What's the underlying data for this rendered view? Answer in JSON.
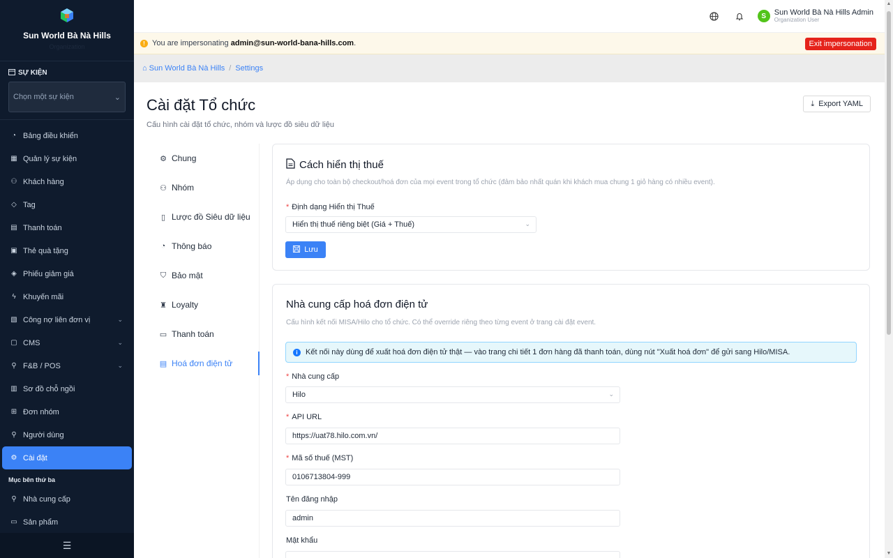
{
  "sidebar": {
    "brand_name": "Sun World Bà Nà Hills",
    "brand_sub": "Organization",
    "event_label": "SỰ KIỆN",
    "event_placeholder": "Chọn một sự kiện",
    "items": [
      {
        "label": "Bảng điều khiển",
        "icon": "dashboard-icon"
      },
      {
        "label": "Quản lý sự kiện",
        "icon": "calendar-icon"
      },
      {
        "label": "Khách hàng",
        "icon": "users-icon"
      },
      {
        "label": "Tag",
        "icon": "tag-icon"
      },
      {
        "label": "Thanh toán",
        "icon": "payment-icon"
      },
      {
        "label": "Thẻ quà tặng",
        "icon": "gift-icon"
      },
      {
        "label": "Phiếu giảm giá",
        "icon": "coupon-icon"
      },
      {
        "label": "Khuyến mãi",
        "icon": "promotion-icon"
      },
      {
        "label": "Công nợ liên đơn vị",
        "icon": "debt-icon"
      },
      {
        "label": "CMS",
        "icon": "cms-icon"
      },
      {
        "label": "F&B / POS",
        "icon": "fnb-icon"
      },
      {
        "label": "Sơ đồ chỗ ngồi",
        "icon": "seatmap-icon"
      },
      {
        "label": "Đơn nhóm",
        "icon": "group-order-icon"
      },
      {
        "label": "Người dùng",
        "icon": "user-icon"
      },
      {
        "label": "Cài đặt",
        "icon": "settings-icon"
      }
    ],
    "group_label": "Mục bên thứ ba",
    "third_party": [
      {
        "label": "Nhà cung cấp",
        "icon": "supplier-icon"
      },
      {
        "label": "Sản phẩm",
        "icon": "product-icon"
      }
    ]
  },
  "topbar": {
    "user_name": "Sun World Bà Nà Hills Admin",
    "user_role": "Organization User",
    "avatar_letter": "S"
  },
  "banner": {
    "prefix": "You are impersonating ",
    "email": "admin@sun-world-bana-hills.com",
    "suffix": ".",
    "exit_label": "Exit impersonation"
  },
  "breadcrumb": {
    "home": "Sun World Bà Nà Hills",
    "current": "Settings"
  },
  "page": {
    "title": "Cài đặt Tổ chức",
    "subtitle": "Cấu hình cài đặt tổ chức, nhóm và lược đồ siêu dữ liệu",
    "export_label": "Export YAML"
  },
  "subnav": [
    {
      "label": "Chung",
      "icon": "gear-icon"
    },
    {
      "label": "Nhóm",
      "icon": "team-icon"
    },
    {
      "label": "Lược đồ Siêu dữ liệu",
      "icon": "schema-icon"
    },
    {
      "label": "Thông báo",
      "icon": "bell-icon"
    },
    {
      "label": "Bảo mật",
      "icon": "shield-icon"
    },
    {
      "label": "Loyalty",
      "icon": "trophy-icon"
    },
    {
      "label": "Thanh toán",
      "icon": "card-icon"
    },
    {
      "label": "Hoá đơn điện tử",
      "icon": "invoice-icon"
    }
  ],
  "tax_card": {
    "title": "Cách hiển thị thuế",
    "desc": "Áp dụng cho toàn bộ checkout/hoá đơn của mọi event trong tổ chức (đảm bảo nhất quán khi khách mua chung 1 giỏ hàng có nhiều event).",
    "field_label": "Định dạng Hiển thị Thuế",
    "field_value": "Hiển thị thuế riêng biệt (Giá + Thuế)",
    "save_label": "Lưu"
  },
  "einvoice_card": {
    "title": "Nhà cung cấp hoá đơn điện tử",
    "desc": "Cấu hình kết nối MISA/Hilo cho tổ chức. Có thể override riêng theo từng event ở trang cài đặt event.",
    "info": "Kết nối này dùng để xuất hoá đơn điện tử thật — vào trang chi tiết 1 đơn hàng đã thanh toán, dùng nút \"Xuất hoá đơn\" để gửi sang Hilo/MISA.",
    "provider_label": "Nhà cung cấp",
    "provider_value": "Hilo",
    "api_label": "API URL",
    "api_value": "https://uat78.hilo.com.vn/",
    "tax_label": "Mã số thuế (MST)",
    "tax_value": "0106713804-999",
    "username_label": "Tên đăng nhập",
    "username_value": "admin",
    "password_label": "Mật khẩu"
  }
}
